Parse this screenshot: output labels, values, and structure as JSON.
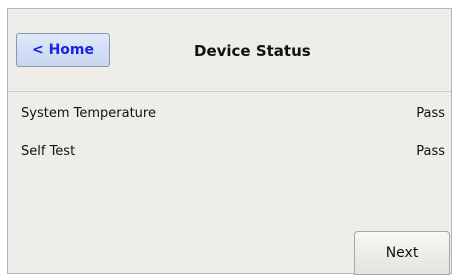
{
  "header": {
    "home_button_label": "< Home",
    "title": "Device Status"
  },
  "status_rows": [
    {
      "label": "System Temperature",
      "value": "Pass"
    },
    {
      "label": "Self Test",
      "value": "Pass"
    }
  ],
  "footer": {
    "next_button_label": "Next"
  },
  "colors": {
    "panel_background": "#efede9",
    "home_label_color": "#1a22e6"
  }
}
